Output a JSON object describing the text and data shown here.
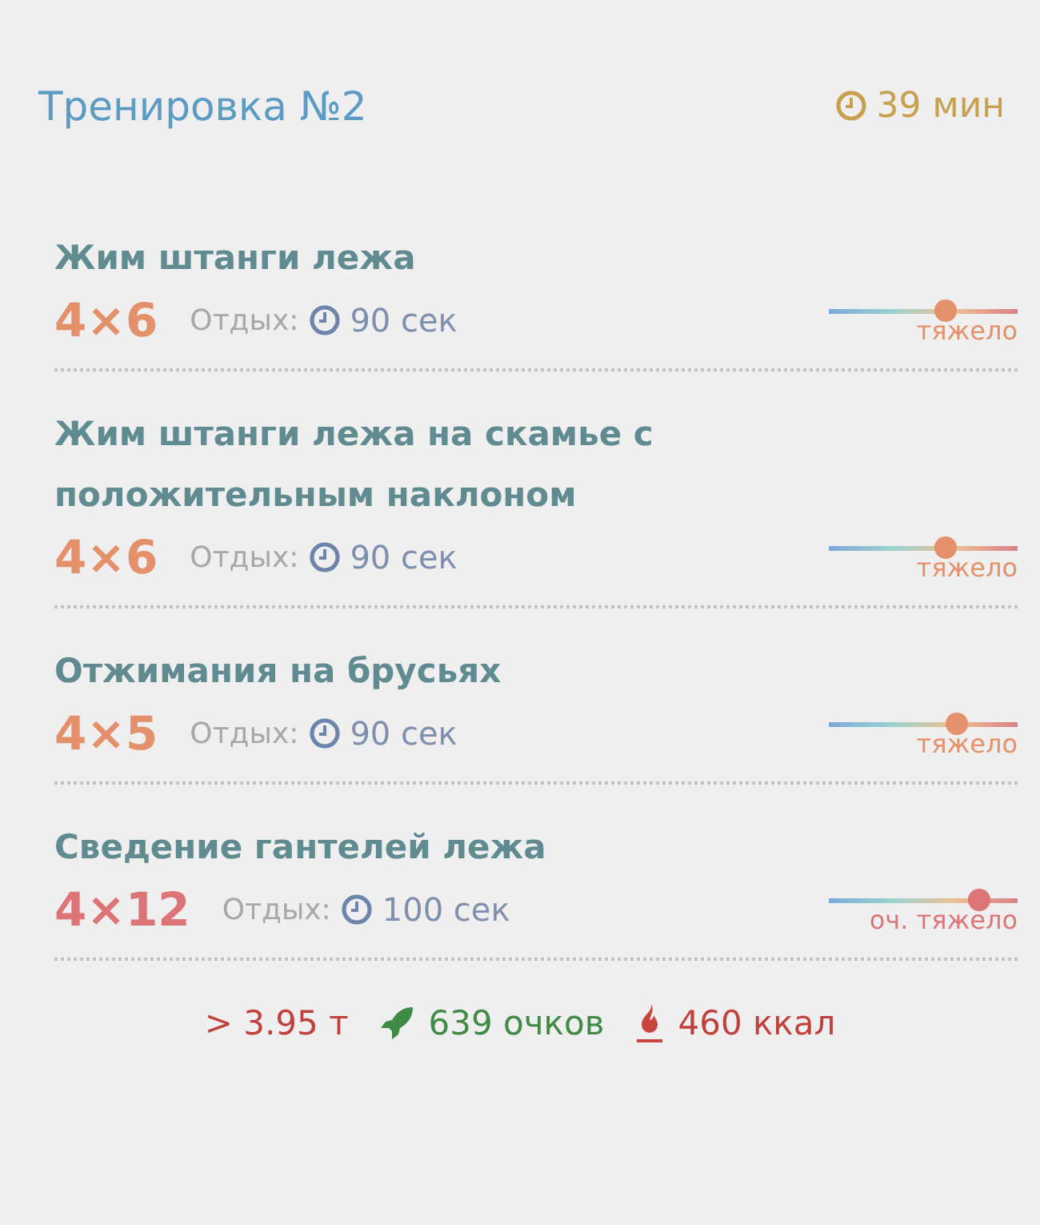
{
  "header": {
    "title": "Тренировка №2",
    "duration": "39 мин"
  },
  "exercises": [
    {
      "name": "Жим штанги лежа",
      "sets": "4×6",
      "rest_label": "Отдых:",
      "rest": "90 сек",
      "level": 0.62,
      "intensity": "тяжело",
      "color": "#e4906a"
    },
    {
      "name": "Жим штанги лежа на скамье с положительным наклоном",
      "sets": "4×6",
      "rest_label": "Отдых:",
      "rest": "90 сек",
      "level": 0.62,
      "intensity": "тяжело",
      "color": "#e4906a"
    },
    {
      "name": "Отжимания на брусьях",
      "sets": "4×5",
      "rest_label": "Отдых:",
      "rest": "90 сек",
      "level": 0.68,
      "intensity": "тяжело",
      "color": "#e4906a"
    },
    {
      "name": "Сведение гантелей лежа",
      "sets": "4×12",
      "rest_label": "Отдых:",
      "rest": "100 сек",
      "level": 0.8,
      "intensity": "оч. тяжело",
      "color": "#dc7478"
    }
  ],
  "summary": {
    "tonnage": "> 3.95 т",
    "points": "639 очков",
    "calories": "460 ккал"
  }
}
